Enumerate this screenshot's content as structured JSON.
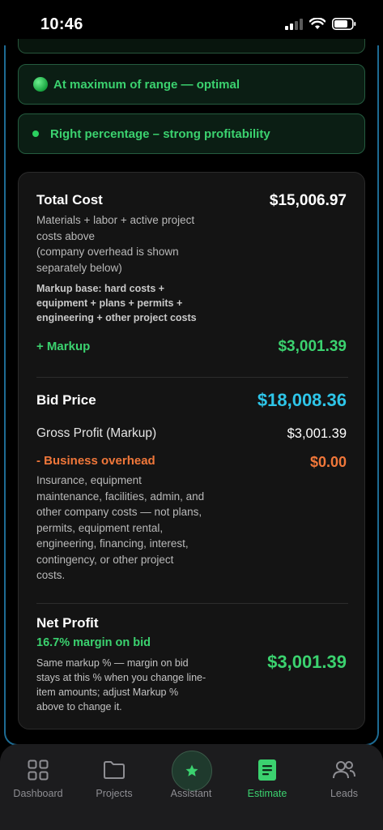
{
  "status_bar": {
    "time": "10:46"
  },
  "indicators": {
    "range": "At maximum of range — optimal",
    "percentage": "Right percentage – strong profitability"
  },
  "summary": {
    "total_cost_label": "Total Cost",
    "total_cost_value": "$15,006.97",
    "total_cost_desc_1": "Materials + labor + active project",
    "total_cost_desc_2": "costs above",
    "total_cost_desc_3": "(company overhead is shown",
    "total_cost_desc_4": "separately below)",
    "markup_base_1": "Markup base: hard costs +",
    "markup_base_2": "equipment + plans + permits +",
    "markup_base_3": "engineering + other project costs",
    "markup_label": "+ Markup",
    "markup_value": "$3,001.39",
    "bid_price_label": "Bid Price",
    "bid_price_value": "$18,008.36",
    "gross_profit_label": "Gross Profit (Markup)",
    "gross_profit_value": "$3,001.39",
    "overhead_label": "- Business overhead",
    "overhead_value": "$0.00",
    "overhead_desc_1": "Insurance, equipment",
    "overhead_desc_2": "maintenance, facilities, admin, and",
    "overhead_desc_3": "other company costs — not plans,",
    "overhead_desc_4": "permits, equipment rental,",
    "overhead_desc_5": "engineering, financing, interest,",
    "overhead_desc_6": "contingency, or other project",
    "overhead_desc_7": "costs.",
    "net_profit_label": "Net Profit",
    "net_margin": "16.7% margin on bid",
    "net_desc_1": "Same markup % — margin on bid",
    "net_desc_2": "stays at this % when you change line-",
    "net_desc_3": "item amounts; adjust Markup %",
    "net_desc_4": "above to change it.",
    "net_profit_value": "$3,001.39"
  },
  "nav": {
    "items": [
      {
        "label": "Dashboard",
        "icon": "grid-icon"
      },
      {
        "label": "Projects",
        "icon": "folder-icon"
      },
      {
        "label": "Assistant",
        "icon": "star-icon"
      },
      {
        "label": "Estimate",
        "icon": "document-icon"
      },
      {
        "label": "Leads",
        "icon": "people-icon"
      }
    ],
    "active": "Estimate"
  },
  "colors": {
    "accent_green": "#3bd26f",
    "accent_blue": "#2ec5e8",
    "accent_orange": "#f0773a",
    "card_bg": "#141414"
  }
}
